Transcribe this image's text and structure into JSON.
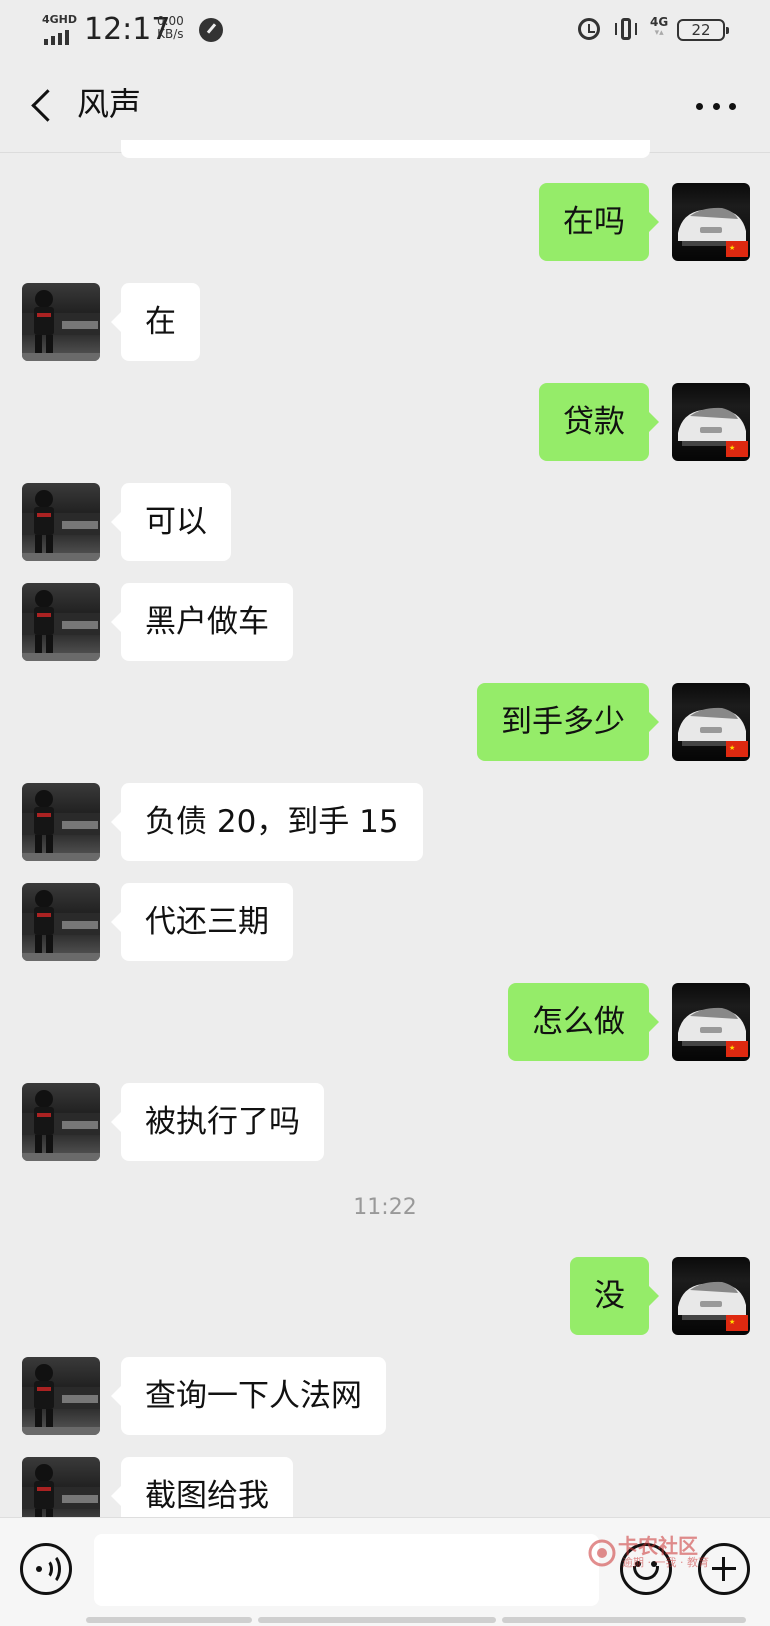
{
  "status_bar": {
    "network_label": "4GHD",
    "time": "12:17",
    "speed_value": "0.00",
    "speed_unit": "KB/s",
    "network_right": "4G",
    "battery": "22"
  },
  "header": {
    "title": "风声"
  },
  "colors": {
    "background": "#ededed",
    "sent_bubble": "#95ec69",
    "received_bubble": "#ffffff"
  },
  "messages": [
    {
      "side": "right",
      "text": "在吗"
    },
    {
      "side": "left",
      "text": "在"
    },
    {
      "side": "right",
      "text": "贷款"
    },
    {
      "side": "left",
      "text": "可以"
    },
    {
      "side": "left",
      "text": "黑户做车"
    },
    {
      "side": "right",
      "text": "到手多少"
    },
    {
      "side": "left",
      "text": "负债 20，到手 15"
    },
    {
      "side": "left",
      "text": "代还三期"
    },
    {
      "side": "right",
      "text": "怎么做"
    },
    {
      "side": "left",
      "text": "被执行了吗"
    },
    {
      "side": "right",
      "text": "没"
    },
    {
      "side": "left",
      "text": "查询一下人法网"
    },
    {
      "side": "left",
      "text": "截图给我"
    }
  ],
  "timestamp": "11:22",
  "input_bar": {
    "input_value": "",
    "icons": [
      "voice-icon",
      "emoji-icon",
      "plus-icon"
    ]
  },
  "watermark": {
    "text": "卡农社区",
    "sub": "逾期 · 一我 · 教育"
  }
}
